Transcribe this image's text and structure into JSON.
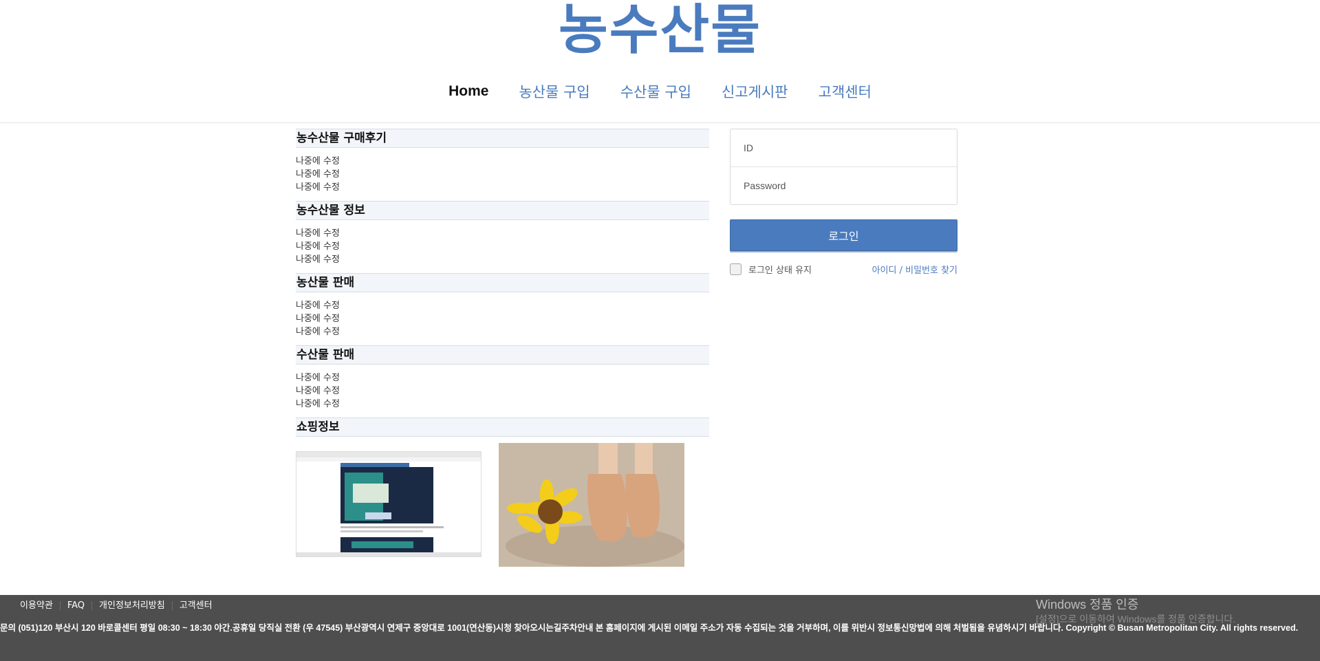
{
  "header": {
    "site_title": "농수산물",
    "nav": [
      {
        "label": "Home"
      },
      {
        "label": "농산물 구입"
      },
      {
        "label": "수산물 구입"
      },
      {
        "label": "신고게시판"
      },
      {
        "label": "고객센터"
      }
    ]
  },
  "main": {
    "sections": [
      {
        "title": "농수산물 구매후기",
        "items": [
          "나중에 수정",
          "나중에 수정",
          "나중에 수정"
        ]
      },
      {
        "title": "농수산물 정보",
        "items": [
          "나중에 수정",
          "나중에 수정",
          "나중에 수정"
        ]
      },
      {
        "title": "농산물 판매",
        "items": [
          "나중에 수정",
          "나중에 수정",
          "나중에 수정"
        ]
      },
      {
        "title": "수산물 판매",
        "items": [
          "나중에 수정",
          "나중에 수정",
          "나중에 수정"
        ]
      }
    ],
    "shopping": {
      "title": "쇼핑정보"
    }
  },
  "login": {
    "id_placeholder": "ID",
    "password_placeholder": "Password",
    "login_button": "로그인",
    "keep_login": "로그인 상태 유지",
    "find_account": "아이디 / 비밀번호 찾기"
  },
  "footer": {
    "links": [
      "이용약관",
      "FAQ",
      "개인정보처리방침",
      "고객센터"
    ],
    "info": "문의 (051)120 부산시 120 바로콜센터 평일 08:30 ~ 18:30 야간.공휴일 당직실 전환 (우 47545) 부산광역시 연제구 중앙대로 1001(연산동)시청 찾아오시는길주차안내 본 홈페이지에 게시된 이메일 주소가 자동 수집되는 것을 거부하며, 이를 위반시 정보통신망법에 의해 처벌됨을 유념하시기 바랍니다. Copyright © Busan Metropolitan City. All rights reserved."
  },
  "windows_notice": {
    "title": "Windows 정품 인증",
    "subtitle": "[설정]으로 이동하여 Windows를 정품 인증합니다."
  }
}
